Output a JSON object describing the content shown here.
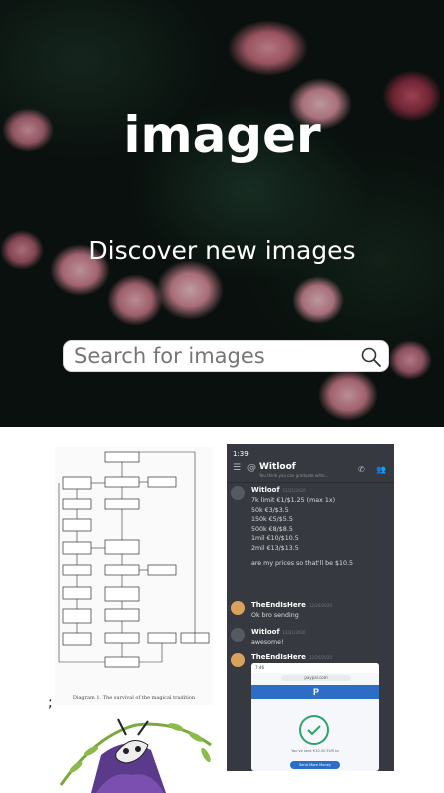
{
  "site": {
    "title": "imager",
    "tagline": "Discover new images"
  },
  "search": {
    "placeholder": "Search for images",
    "value": ""
  },
  "gallery": {
    "diagram_caption": "Diagram 1. The survival of the magical tradition",
    "stray_text": ";",
    "chat": {
      "status_time": "1:39",
      "header_name": "Witloof",
      "header_sub": "You think you can graduate witlo...",
      "messages": [
        {
          "author": "Witloof",
          "time": "12/21/2020",
          "lines": [
            "7k limit €1/$1.25 (max 1x)",
            "50k €3/$3.5",
            "150k €5/$5.5",
            "500k €8/$8.5",
            "1mil €10/$10.5",
            "2mil €13/$13.5",
            "",
            "are my prices so that'll be $10.5"
          ]
        },
        {
          "author": "TheEndIsHere",
          "time": "12/20/2020",
          "lines": [
            "Ok bro sending"
          ]
        },
        {
          "author": "Witloof",
          "time": "12/21/2020",
          "lines": [
            "awesome!"
          ]
        },
        {
          "author": "TheEndIsHere",
          "time": "12/20/2020",
          "lines": []
        }
      ],
      "paypal_time": "7:46",
      "paypal_url": "paypal.com",
      "paypal_note": "You've sent €10.50 EUR to",
      "paypal_button": "Send More Money"
    }
  },
  "colors": {
    "hero_overlay": "#000000",
    "chat_bg": "#36393f",
    "paypal_blue": "#2c6dc5",
    "success_green": "#2ea46b"
  }
}
